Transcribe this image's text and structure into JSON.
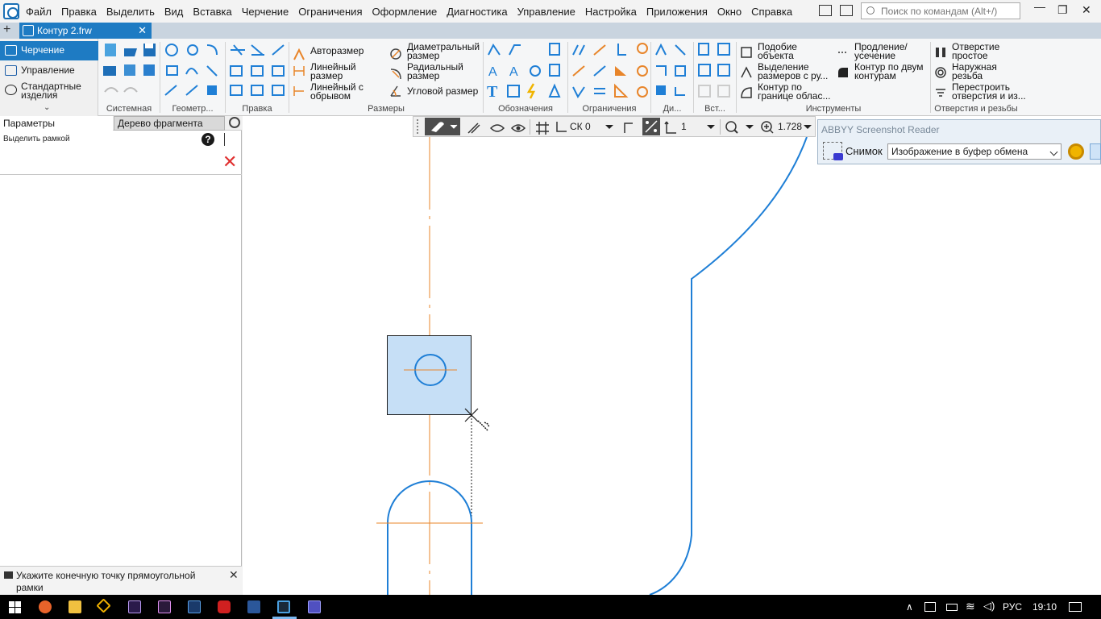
{
  "menu": {
    "items": [
      "Файл",
      "Правка",
      "Выделить",
      "Вид",
      "Вставка",
      "Черчение",
      "Ограничения",
      "Оформление",
      "Диагностика",
      "Управление",
      "Настройка",
      "Приложения",
      "Окно",
      "Справка"
    ],
    "search_placeholder": "Поиск по командам (Alt+/)"
  },
  "tabs": {
    "document": "Контур 2.frw",
    "add_icon": "plus-icon",
    "close_icon": "close-icon"
  },
  "left_tabs": {
    "items": [
      {
        "label": "Черчение",
        "icon": "drafting-icon",
        "active": true
      },
      {
        "label": "Управление",
        "icon": "management-icon",
        "active": false
      },
      {
        "label": "Стандартные изделия",
        "icon": "standard-parts-icon",
        "active": false
      }
    ],
    "expand_icon": "double-chevron-down-icon"
  },
  "ribbon": {
    "group_captions": [
      "Системная",
      "Геометр...",
      "Правка",
      "Размеры",
      "Обозначения",
      "Ограничения",
      "Ди...",
      "Вст...",
      "Инструменты",
      "Отверстия и резьбы"
    ],
    "dimensions": {
      "auto": "Авторазмер",
      "linear": "Линейный размер",
      "linear_break": "Линейный с обрывом",
      "diameter": "Диаметральный размер",
      "radial": "Радиальный размер",
      "angular": "Угловой размер"
    },
    "tools": {
      "similar": "Подобие объекта",
      "select_dims": "Выделение размеров с ру...",
      "contour_region": "Контур по границе облас...",
      "extend": "Продление/ усечение",
      "contour_two": "Контур по двум контурам"
    },
    "holes": {
      "simple_hole": "Отверстие простое",
      "ext_thread": "Наружная резьба",
      "rebuild": "Перестроить отверстия и из..."
    }
  },
  "left_panel": {
    "tab_params": "Параметры",
    "tab_tree": "Дерево фрагмента",
    "mode": "Выделить рамкой",
    "help_label": "?",
    "close_label": "✕",
    "hint": "Укажите конечную точку прямоугольной рамки",
    "hint_close": "✕"
  },
  "view_toolbar": {
    "coord_system": "СК 0",
    "layer": "1",
    "zoom": "1.728"
  },
  "abbyy": {
    "title": "ABBYY Screenshot Reader",
    "snapshot_label": "Снимок",
    "mode_value": "Изображение в буфер обмена"
  },
  "taskbar": {
    "lang": "РУС",
    "time": "19:10",
    "apps": [
      "windows-start-icon",
      "firefox-icon",
      "file-explorer-icon",
      "archiver-icon",
      "after-effects-icon",
      "premiere-icon",
      "visio-icon",
      "downloader-icon",
      "word-icon",
      "kompas-icon",
      "presentation-icon"
    ]
  },
  "colors": {
    "accent": "#1e7bc3",
    "geometry": "#1f7fd6",
    "axis": "#e8852a",
    "selection_fill": "#c6dff6"
  }
}
